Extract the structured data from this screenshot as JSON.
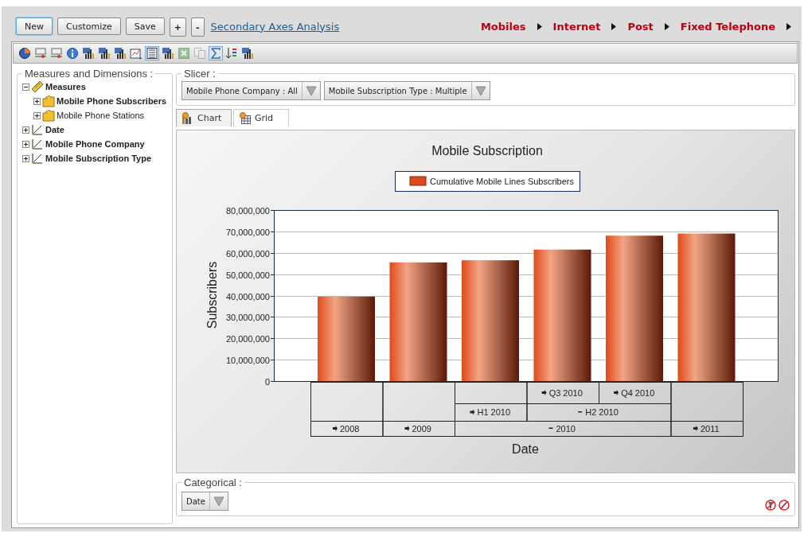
{
  "top_bar": {
    "buttons": [
      {
        "label": "New",
        "focused": true
      },
      {
        "label": "Customize",
        "focused": false
      },
      {
        "label": "Save",
        "focused": false
      },
      {
        "label": "+",
        "focused": false
      },
      {
        "label": "-",
        "focused": false
      }
    ],
    "link": "Secondary Axes Analysis",
    "breadcrumb": [
      "Mobiles",
      "Internet",
      "Post",
      "Fixed Telephone"
    ]
  },
  "toolbar": [
    {
      "kind": "pie",
      "pressed": false,
      "disabled": false
    },
    {
      "kind": "slider",
      "pressed": false,
      "disabled": false
    },
    {
      "kind": "slider",
      "pressed": false,
      "disabled": false
    },
    {
      "kind": "info",
      "pressed": false,
      "disabled": false
    },
    {
      "kind": "chart",
      "pressed": false,
      "disabled": false
    },
    {
      "kind": "chart",
      "pressed": false,
      "disabled": false
    },
    {
      "kind": "chart",
      "pressed": false,
      "disabled": false
    },
    {
      "kind": "wizard",
      "pressed": false,
      "disabled": false
    },
    {
      "kind": "list",
      "pressed": true,
      "disabled": false
    },
    {
      "kind": "chart",
      "pressed": false,
      "disabled": false
    },
    {
      "kind": "spreadsheet",
      "pressed": false,
      "disabled": true
    },
    {
      "kind": "copy",
      "pressed": false,
      "disabled": true
    },
    {
      "kind": "sum",
      "pressed": true,
      "disabled": false
    },
    {
      "kind": "swap",
      "pressed": false,
      "disabled": false
    },
    {
      "kind": "chart",
      "pressed": false,
      "disabled": false
    }
  ],
  "measures_panel": {
    "title": "Measures and Dimensions :",
    "tree": [
      {
        "label": "Measures",
        "kind": "measures",
        "expanded": true,
        "used": true,
        "children": [
          {
            "label": "Mobile Phone Subscribers",
            "kind": "measure_group",
            "expanded": false,
            "used": true
          },
          {
            "label": "Mobile Phone Stations",
            "kind": "measure_group",
            "expanded": false,
            "used": false
          }
        ]
      },
      {
        "label": "Date",
        "kind": "dimension",
        "expanded": false,
        "used": true
      },
      {
        "label": "Mobile Phone Company",
        "kind": "dimension",
        "expanded": false,
        "used": true
      },
      {
        "label": "Mobile Subscription Type",
        "kind": "dimension",
        "expanded": false,
        "used": true
      }
    ]
  },
  "slicer": {
    "title": "Slicer :",
    "filters": [
      "Mobile Phone Company : All",
      "Mobile Subscription Type : Multiple"
    ]
  },
  "tabs": [
    {
      "label": "Chart",
      "kind": "chart",
      "selected": true
    },
    {
      "label": "Grid",
      "kind": "grid",
      "selected": false
    }
  ],
  "chart": {
    "chart_data": {
      "type": "bar",
      "title": "Mobile Subscription",
      "xlabel": "Date",
      "ylabel": "Subscribers",
      "series": [
        {
          "name": "Cumulative Mobile Lines Subscribers",
          "color": "#e04a1a",
          "values": [
            39500000,
            55500000,
            56500000,
            61500000,
            68000000,
            69000000
          ]
        }
      ],
      "ylim": [
        0,
        80000000
      ],
      "grid": true,
      "yticks": [
        {
          "value": 0,
          "label": "0"
        },
        {
          "value": 10000000,
          "label": "10,000,000"
        },
        {
          "value": 20000000,
          "label": "20,000,000"
        },
        {
          "value": 30000000,
          "label": "30,000,000"
        },
        {
          "value": 40000000,
          "label": "40,000,000"
        },
        {
          "value": 50000000,
          "label": "50,000,000"
        },
        {
          "value": 60000000,
          "label": "60,000,000"
        },
        {
          "value": 70000000,
          "label": "70,000,000"
        },
        {
          "value": 80000000,
          "label": "80,000,000"
        }
      ]
    },
    "category_tree": [
      {
        "label": "2008",
        "expanded": false
      },
      {
        "label": "2009",
        "expanded": false
      },
      {
        "label": "2010",
        "expanded": true,
        "children": [
          {
            "label": "H1 2010",
            "expanded": false
          },
          {
            "label": "H2 2010",
            "expanded": true,
            "children": [
              {
                "label": "Q3 2010",
                "expanded": false
              },
              {
                "label": "Q4 2010",
                "expanded": false
              }
            ]
          }
        ]
      },
      {
        "label": "2011",
        "expanded": false
      }
    ]
  },
  "categorical": {
    "title": "Categorical :",
    "fields": [
      "Date"
    ]
  }
}
